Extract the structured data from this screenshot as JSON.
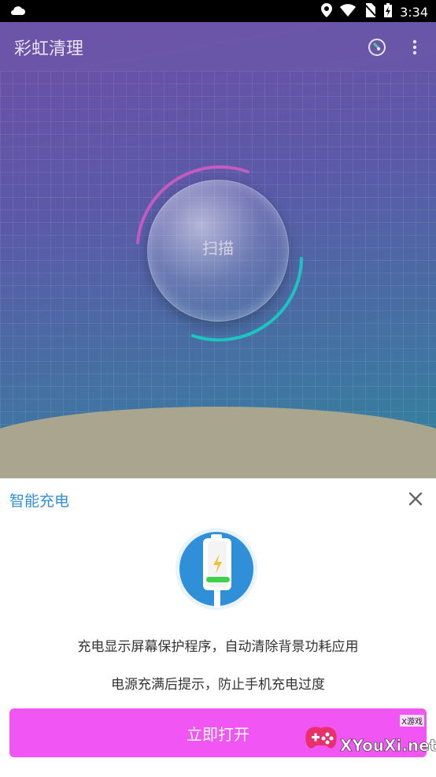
{
  "status_bar": {
    "time": "3:34"
  },
  "toolbar": {
    "title": "彩虹清理"
  },
  "scan": {
    "label": "扫描"
  },
  "sheet": {
    "title": "智能充电",
    "desc1": "充电显示屏幕保护程序，自动清除背景功耗应用",
    "desc2": "电源充满后提示，防止手机充电过度",
    "button": "立即打开"
  },
  "watermark": {
    "small": "X游戏",
    "text": "XYouXi.net"
  },
  "colors": {
    "accent": "#f155f3",
    "title_blue": "#2f8fd8",
    "ground": "#a9a58f"
  }
}
